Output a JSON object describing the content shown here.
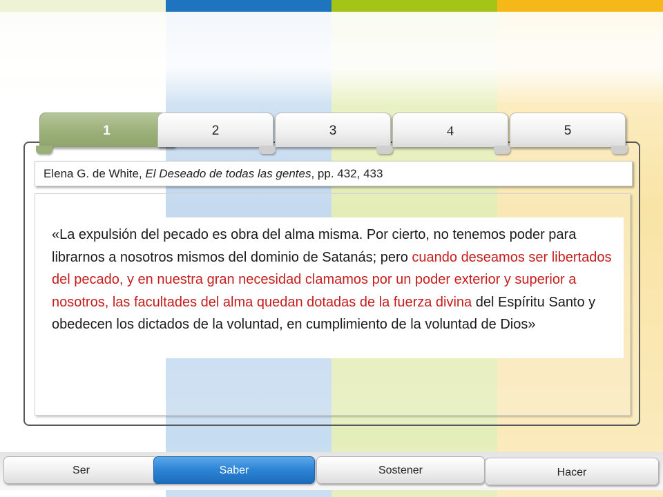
{
  "colors": {
    "top_strip": [
      "#eef3d6",
      "#1f74c0",
      "#a4c418",
      "#f6b818"
    ],
    "active_tab": "#9bb079",
    "active_nav": "#2c83d4",
    "highlight_text": "#c71c1c"
  },
  "tabs": [
    {
      "label": "1",
      "active": true
    },
    {
      "label": "2",
      "active": false
    },
    {
      "label": "3",
      "active": false
    },
    {
      "label": "4",
      "active": false
    },
    {
      "label": "5",
      "active": false
    }
  ],
  "source": {
    "author": "Elena G. de White, ",
    "book": "El Deseado de todas las gentes",
    "pages": ", pp. 432, 433"
  },
  "quote": {
    "part1": "«La expulsión del pecado es obra del alma misma. Por cierto, no tenemos poder para librarnos a nosotros mismos del dominio de Satanás; pero ",
    "highlight": "cuando deseamos ser libertados del pecado, y en nuestra gran necesidad clamamos por un poder exterior y superior a nosotros, las facultades del alma quedan dotadas de la fuerza divina",
    "part2": " del Espíritu Santo y obedecen los dictados de la voluntad, en cumplimiento de la voluntad de Dios»"
  },
  "nav": [
    {
      "label": "Ser",
      "active": false
    },
    {
      "label": "Saber",
      "active": true
    },
    {
      "label": "Sostener",
      "active": false
    },
    {
      "label": "Hacer",
      "active": false
    }
  ]
}
